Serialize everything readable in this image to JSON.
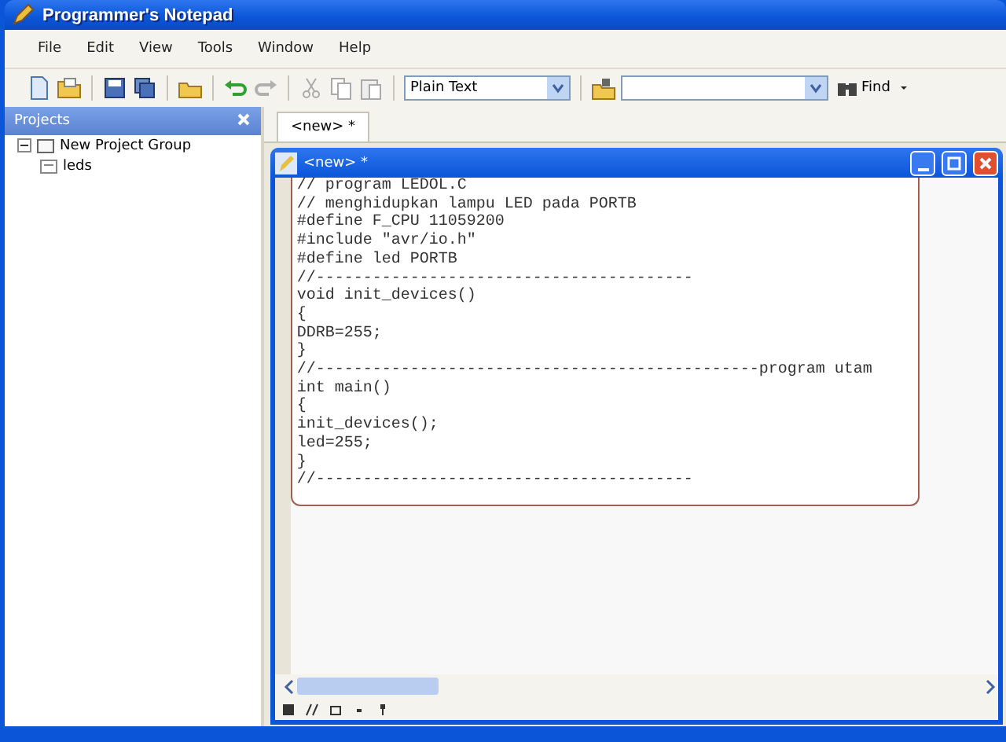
{
  "window": {
    "title": "Programmer's Notepad"
  },
  "menu": [
    "File",
    "Edit",
    "View",
    "Tools",
    "Window",
    "Help"
  ],
  "toolbar": {
    "scheme": "Plain Text",
    "find_label": "Find"
  },
  "projects": {
    "title": "Projects",
    "tree": [
      {
        "label": "New Project Group",
        "expanded": true,
        "children": [
          {
            "label": "leds"
          }
        ]
      }
    ]
  },
  "tabs": [
    {
      "label": "<new> *",
      "selected": true
    }
  ],
  "editor": {
    "title": "<new> *",
    "lines": [
      "// program LEDOL.C",
      "// menghidupkan lampu LED pada PORTB",
      "#define F_CPU 11059200",
      "#include \"avr/io.h\"",
      "#define led PORTB",
      "//----------------------------------------",
      "void init_devices()",
      "{",
      "DDRB=255;",
      "}",
      "//-----------------------------------------------program utam",
      "int main()",
      "{",
      "init_devices();",
      "led=255;",
      "}",
      "//----------------------------------------"
    ]
  }
}
